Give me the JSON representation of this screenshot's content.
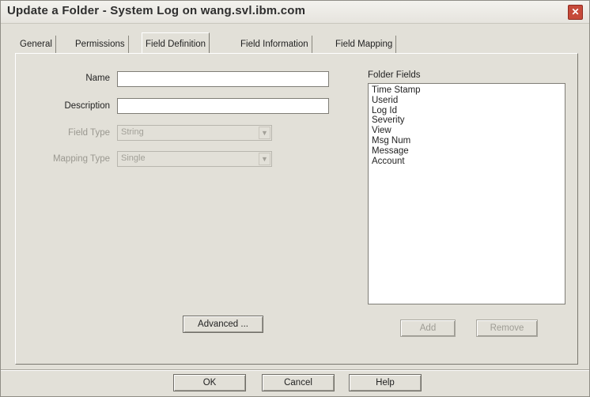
{
  "window": {
    "title": "Update a Folder - System Log on wang.svl.ibm.com",
    "close_glyph": "✕"
  },
  "tabs": [
    "General",
    "Permissions",
    "Field Definition",
    "Field Information",
    "Field Mapping"
  ],
  "active_tab": "Field Definition",
  "form": {
    "name_label": "Name",
    "name_value": "",
    "description_label": "Description",
    "description_value": "",
    "field_type_label": "Field Type",
    "field_type_value": "String",
    "mapping_type_label": "Mapping Type",
    "mapping_type_value": "Single",
    "advanced_button": "Advanced ..."
  },
  "folder_fields": {
    "label": "Folder Fields",
    "items": [
      "Time Stamp",
      "Userid",
      "Log Id",
      "Severity",
      "View",
      "Msg Num",
      "Message",
      "Account"
    ],
    "add_button": "Add",
    "remove_button": "Remove"
  },
  "footer": {
    "ok_button": "OK",
    "cancel_button": "Cancel",
    "help_button": "Help"
  },
  "colors": {
    "dialog_bg": "#e2e0d8",
    "close_button": "#c64a3a",
    "disabled_text": "#9a9890"
  }
}
